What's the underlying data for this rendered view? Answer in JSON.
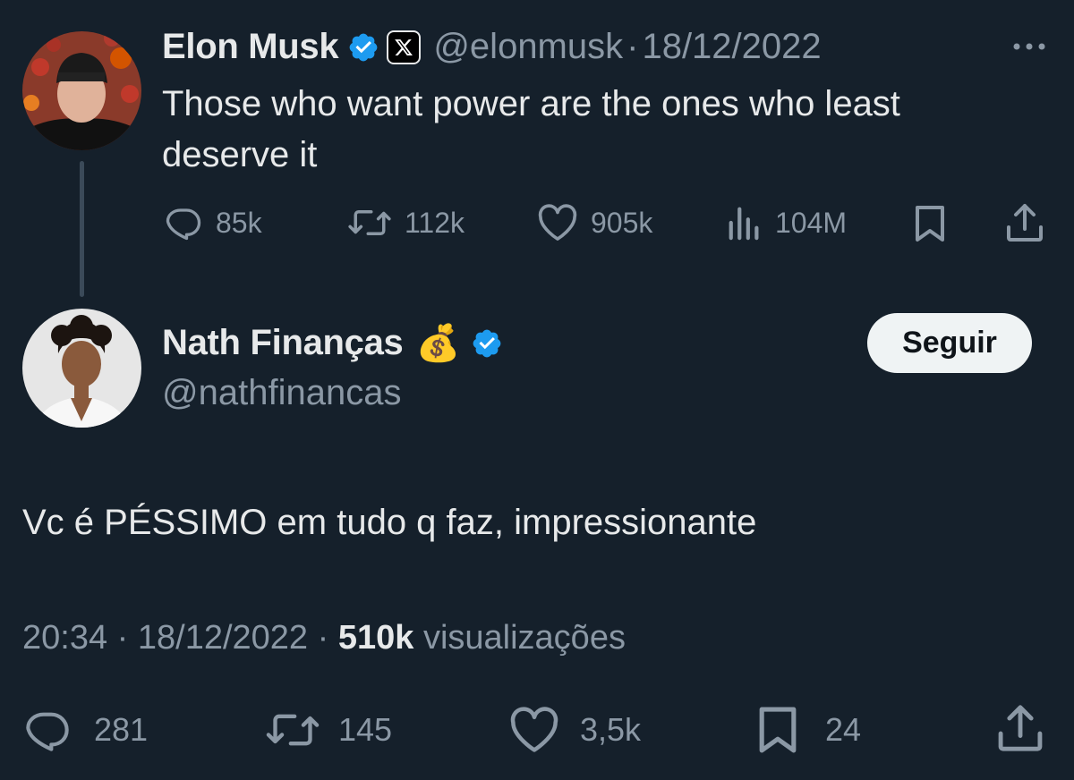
{
  "colors": {
    "background": "#15202b",
    "text": "#e7e9ea",
    "muted": "#8b98a5",
    "verified": "#1d9bf0",
    "thread_line": "#3b4a59",
    "follow_bg": "#eff3f4"
  },
  "parent_tweet": {
    "author": {
      "name": "Elon Musk",
      "handle": "@elonmusk",
      "verified_icon": "verified-badge-icon",
      "affiliation_icon": "x-logo-icon"
    },
    "separator": "·",
    "date": "18/12/2022",
    "more_icon": "more-icon",
    "text_line1": "Those who want power are the ones who least",
    "text_line2": "deserve it",
    "actions": {
      "replies": "85k",
      "retweets": "112k",
      "likes": "905k",
      "views": "104M"
    }
  },
  "reply_tweet": {
    "author": {
      "name": "Nath Finanças",
      "emoji": "💰",
      "handle": "@nathfinancas",
      "verified_icon": "verified-badge-icon"
    },
    "follow_label": "Seguir",
    "text": "Vc é PÉSSIMO em tudo q faz, impressionante",
    "meta": {
      "time": "20:34",
      "sep1": "·",
      "date": "18/12/2022",
      "sep2": "·",
      "views_count": "510k",
      "views_label": "visualizações"
    },
    "actions": {
      "replies": "281",
      "retweets": "145",
      "likes": "3,5k",
      "bookmarks": "24"
    }
  }
}
